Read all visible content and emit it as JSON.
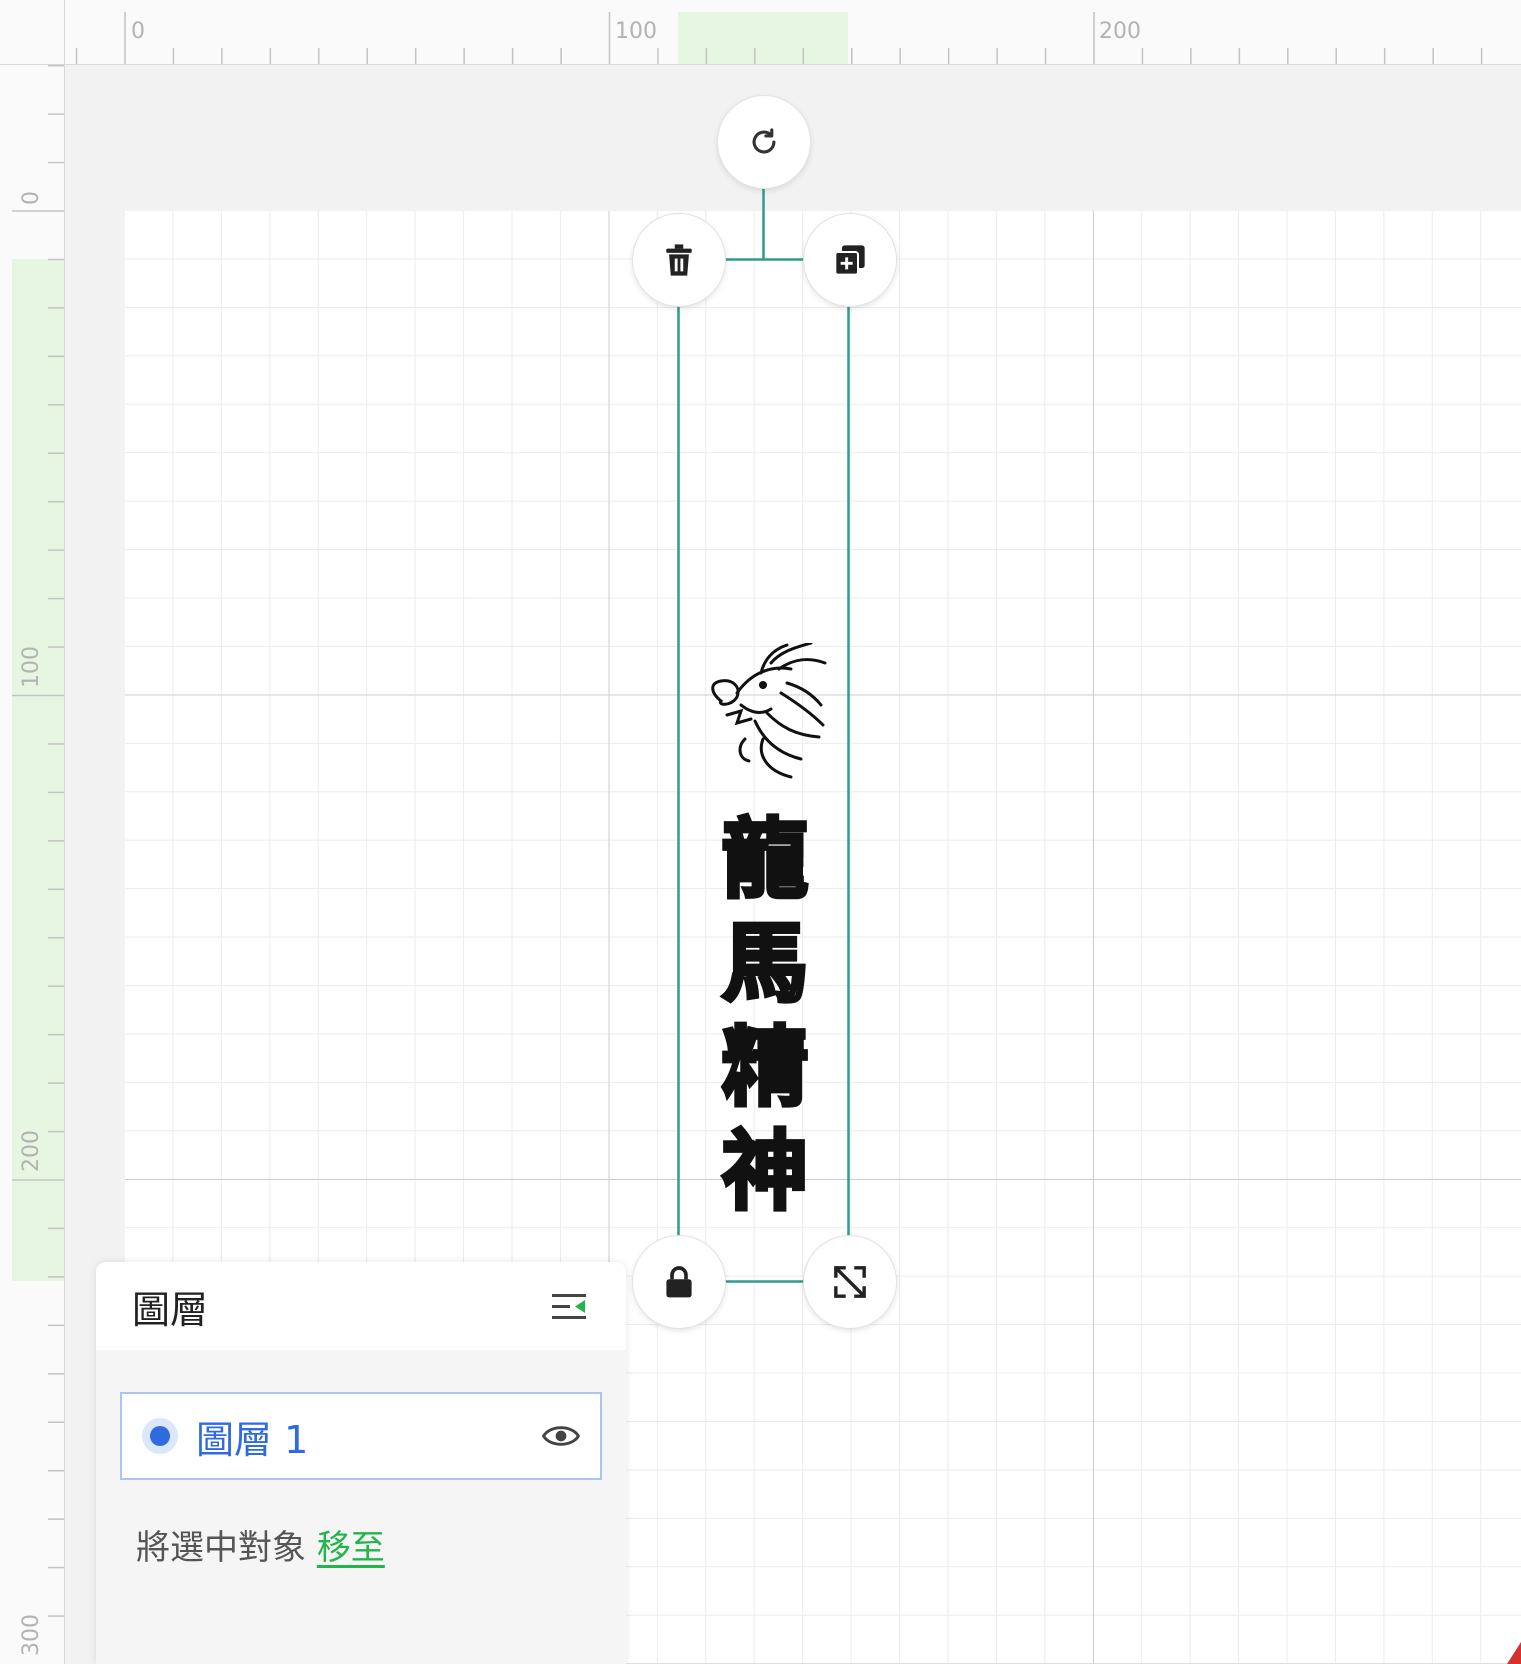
{
  "rulers": {
    "top_labels": [
      "0",
      "100",
      "200"
    ],
    "left_labels": [
      "0",
      "100",
      "200",
      "300"
    ],
    "highlight_color": "#e6f6e1"
  },
  "canvas": {
    "artwork_text": "龍\n馬\n精\n神",
    "artwork_image": "dragon-head-illustration",
    "selection_color": "#2e9c8f"
  },
  "handles": {
    "rotate": "rotate-icon",
    "delete": "trash-icon",
    "duplicate": "duplicate-icon",
    "lock": "lock-icon",
    "resize": "resize-icon"
  },
  "layers_panel": {
    "title": "圖層",
    "collapse_icon": "collapse-panel-icon",
    "layers": [
      {
        "name": "圖層 1",
        "selected": true,
        "visibility_icon": "eye-icon"
      }
    ],
    "move_prefix": "將選中對象 ",
    "move_link": "移至"
  },
  "colors": {
    "accent_blue": "#2f6be0",
    "link_green": "#23b44b"
  }
}
